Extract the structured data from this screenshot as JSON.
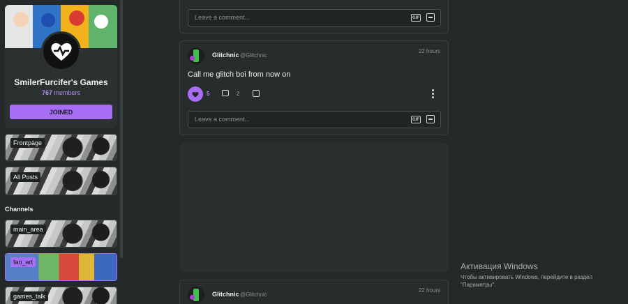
{
  "group": {
    "name": "SmilerFurcifer's Games",
    "members_count": "767",
    "members_label": "members",
    "join_button": "JOINED"
  },
  "nav": {
    "frontpage": "Frontpage",
    "all_posts": "All Posts"
  },
  "channels": {
    "title": "Channels",
    "items": [
      "main_area",
      "fan_art",
      "games_talk"
    ],
    "active": "fan_art"
  },
  "posts": [
    {
      "comment_placeholder": "Leave a comment...",
      "gif_label": "GIF"
    },
    {
      "author": "Glitchnic",
      "handle": "@Glitchnic",
      "time": "22 hours",
      "text": "Call me glitch boi from now on",
      "likes": "5",
      "replies": "2",
      "comment_placeholder": "Leave a comment...",
      "gif_label": "GIF"
    },
    {
      "author": "Glitchnic",
      "handle": "@Glitchnic",
      "time": "22 hours"
    }
  ],
  "watermark": {
    "title": "Активация Windows",
    "subtitle": "Чтобы активировать Windows, перейдите в раздел \"Параметры\"."
  },
  "colors": {
    "accent": "#a76ef5",
    "background": "#242929"
  }
}
